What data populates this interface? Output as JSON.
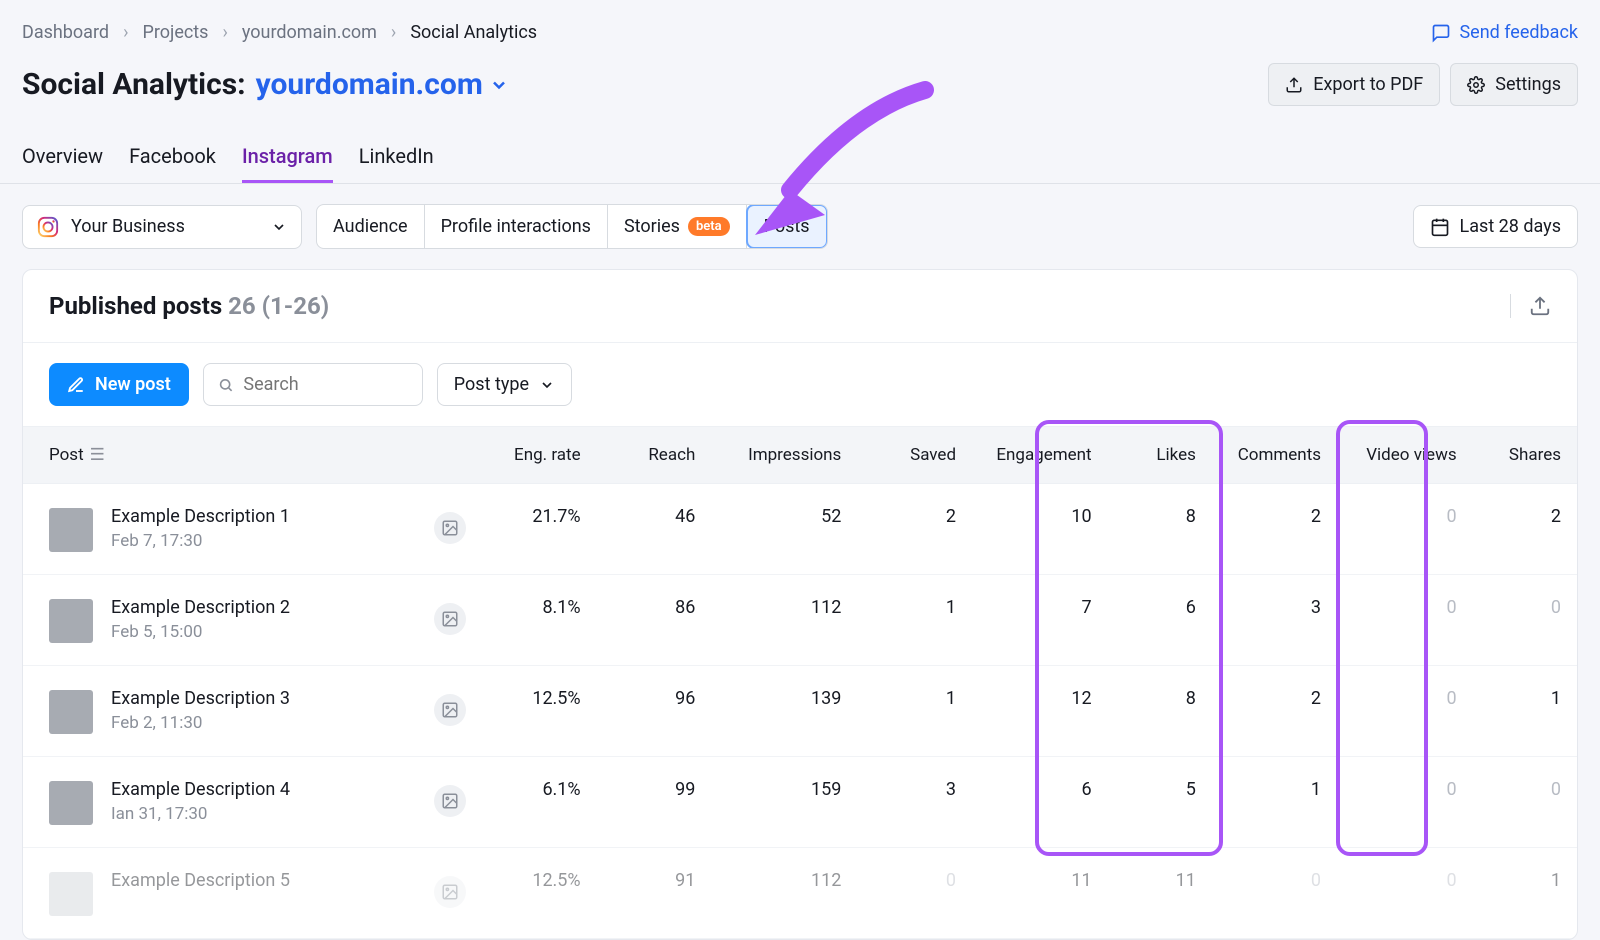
{
  "feedback_label": "Send feedback",
  "breadcrumbs": {
    "items": [
      "Dashboard",
      "Projects",
      "yourdomain.com",
      "Social Analytics"
    ]
  },
  "title": {
    "prefix": "Social Analytics:",
    "domain": "yourdomain.com"
  },
  "actions": {
    "export": "Export to PDF",
    "settings": "Settings"
  },
  "tabs": [
    "Overview",
    "Facebook",
    "Instagram",
    "LinkedIn"
  ],
  "account_label": "Your Business",
  "segments": {
    "audience": "Audience",
    "profile": "Profile interactions",
    "stories": "Stories",
    "stories_badge": "beta",
    "posts": "Posts"
  },
  "date_range": "Last 28 days",
  "card": {
    "title": "Published posts",
    "count_text": "26 (1-26)"
  },
  "toolbar": {
    "new_post": "New post",
    "search_placeholder": "Search",
    "post_type": "Post type"
  },
  "columns": [
    "Post",
    "Eng. rate",
    "Reach",
    "Impressions",
    "Saved",
    "Engagement",
    "Likes",
    "Comments",
    "Video views",
    "Shares"
  ],
  "rows": [
    {
      "title": "Example Description 1",
      "date": "Feb 7, 17:30",
      "eng": "21.7%",
      "reach": "46",
      "imp": "52",
      "saved": "2",
      "engm": "10",
      "likes": "8",
      "comments": "2",
      "views": "0",
      "shares": "2"
    },
    {
      "title": "Example Description 2",
      "date": "Feb 5, 15:00",
      "eng": "8.1%",
      "reach": "86",
      "imp": "112",
      "saved": "1",
      "engm": "7",
      "likes": "6",
      "comments": "3",
      "views": "0",
      "shares": "0"
    },
    {
      "title": "Example Description 3",
      "date": "Feb 2, 11:30",
      "eng": "12.5%",
      "reach": "96",
      "imp": "139",
      "saved": "1",
      "engm": "12",
      "likes": "8",
      "comments": "2",
      "views": "0",
      "shares": "1"
    },
    {
      "title": "Example Description 4",
      "date": "Ian 31, 17:30",
      "eng": "6.1%",
      "reach": "99",
      "imp": "159",
      "saved": "3",
      "engm": "6",
      "likes": "5",
      "comments": "1",
      "views": "0",
      "shares": "0"
    },
    {
      "title": "Example Description 5",
      "date": "",
      "eng": "12.5%",
      "reach": "91",
      "imp": "112",
      "saved": "0",
      "engm": "11",
      "likes": "11",
      "comments": "0",
      "views": "0",
      "shares": "1"
    }
  ]
}
